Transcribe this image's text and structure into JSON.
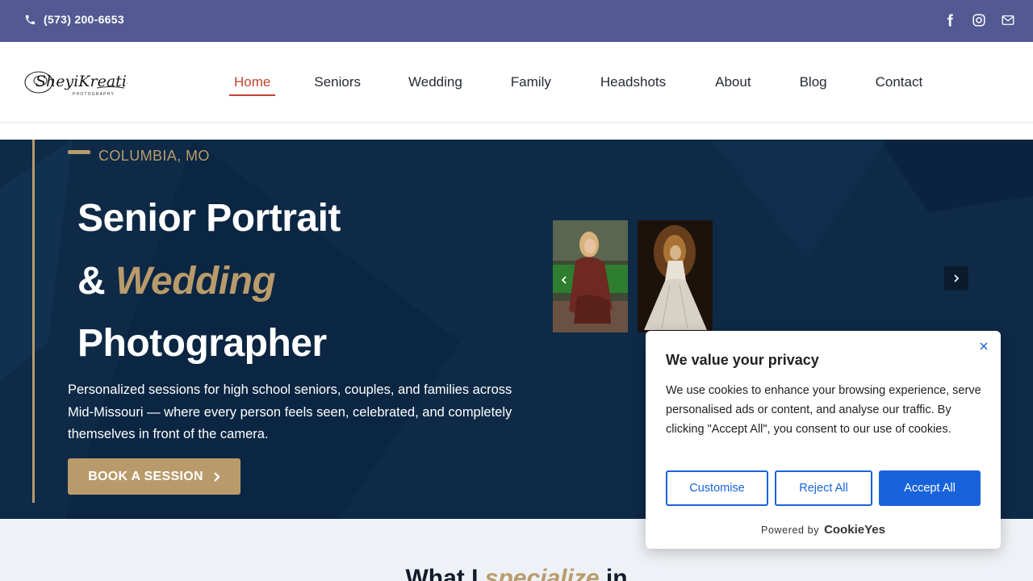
{
  "topbar": {
    "phone": "(573) 200-6653",
    "social": [
      "facebook-icon",
      "instagram-icon",
      "mail-icon"
    ],
    "bg_color": "#535a93"
  },
  "header": {
    "logo_text": "SheyiKreations",
    "logo_sub": "PHOTOGRAPHY",
    "nav": [
      {
        "label": "Home",
        "active": true
      },
      {
        "label": "Seniors"
      },
      {
        "label": "Wedding"
      },
      {
        "label": "Family"
      },
      {
        "label": "Headshots"
      },
      {
        "label": "About"
      },
      {
        "label": "Blog"
      },
      {
        "label": "Contact"
      }
    ]
  },
  "hero": {
    "eyebrow": "COLUMBIA, MO",
    "line1": "Senior Portrait",
    "line2_prefix": "& ",
    "line2_accent": "Wedding",
    "line3": "Photographer",
    "description": "Personalized sessions for high school seniors, couples, and families across Mid-Missouri — where every person feels seen, celebrated, and completely themselves in front of the camera.",
    "cta": "BOOK A SESSION",
    "accent_color": "#b99b6b",
    "bg_color": "#0e2a47"
  },
  "section": {
    "title_prefix": "What I ",
    "title_accent": "specialize",
    "title_suffix": " in"
  },
  "cookie": {
    "title": "We value your privacy",
    "body": "We use cookies to enhance your browsing experience, serve personalised ads or content, and analyse our traffic. By clicking \"Accept All\", you consent to our use of cookies.",
    "customise": "Customise",
    "reject": "Reject All",
    "accept": "Accept All",
    "powered_by": "Powered by",
    "brand": "CookieYes",
    "button_color": "#1863dc"
  }
}
